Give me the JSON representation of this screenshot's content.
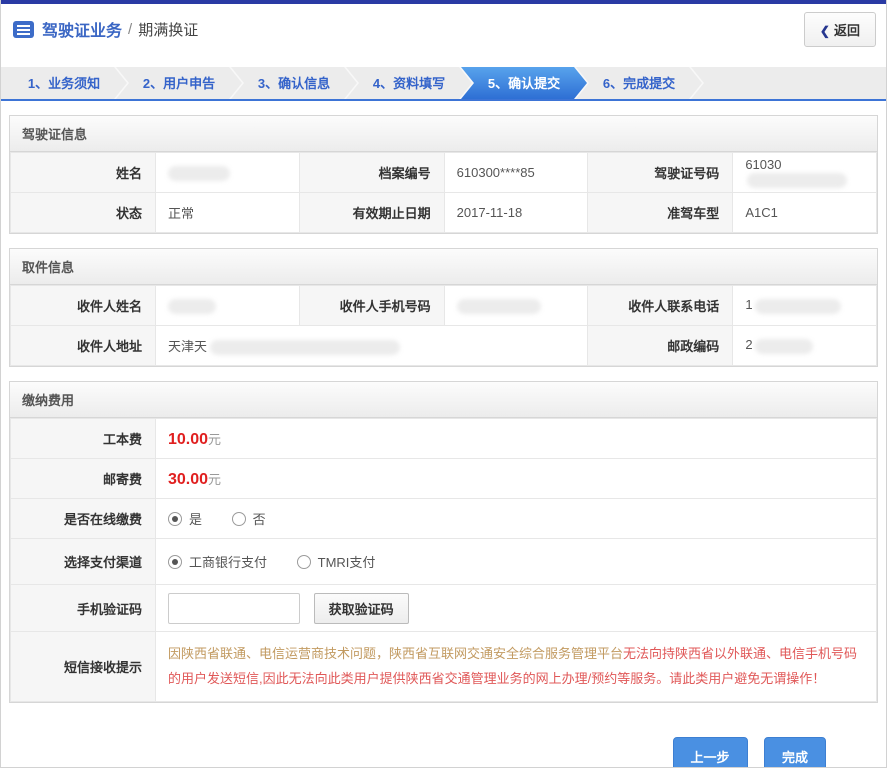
{
  "colors": {
    "accent_blue": "#3d74d6",
    "top_bar": "#2a3aa4",
    "price_red": "#e01f1f",
    "notice_tan": "#c29a60",
    "notice_red": "#e05858"
  },
  "header": {
    "icon": "form-list-icon",
    "title": "驾驶证业务",
    "separator": "/",
    "subtitle": "期满换证",
    "back_chevron": "❮",
    "back_button": "返回"
  },
  "steps": [
    "1、业务须知",
    "2、用户申告",
    "3、确认信息",
    "4、资料填写",
    "5、确认提交",
    "6、完成提交"
  ],
  "active_step": "5、确认提交",
  "license": {
    "title": "驾驶证信息",
    "name_label": "姓名",
    "file_no_label": "档案编号",
    "file_no_value": "610300****85",
    "license_no_label": "驾驶证号码",
    "license_no_prefix": "61030",
    "status_label": "状态",
    "status_value": "正常",
    "expiry_label": "有效期止日期",
    "expiry_value": "2017-11-18",
    "vehicle_label": "准驾车型",
    "vehicle_value": "A1C1"
  },
  "pickup": {
    "title": "取件信息",
    "recipient_name_label": "收件人姓名",
    "recipient_mobile_label": "收件人手机号码",
    "recipient_tel_label": "收件人联系电话",
    "recipient_tel_prefix": "1",
    "address_label": "收件人地址",
    "address_prefix": "天津天",
    "zip_label": "邮政编码",
    "zip_prefix": "2"
  },
  "fees": {
    "title": "缴纳费用",
    "work_fee_label": "工本费",
    "work_fee_value": "10.00",
    "post_fee_label": "邮寄费",
    "post_fee_value": "30.00",
    "fee_unit": "元",
    "online_label": "是否在线缴费",
    "online_yes": "是",
    "online_no": "否",
    "online_selected": "是",
    "channel_label": "选择支付渠道",
    "channel_icbc": "工商银行支付",
    "channel_tmri": "TMRI支付",
    "channel_selected": "工商银行支付",
    "code_label": "手机验证码",
    "code_input_value": "",
    "get_code_button": "获取验证码",
    "sms_label": "短信接收提示",
    "sms_notice_part1": "因陕西省联通、电信运营商技术问题，陕西省互联网交通安全综合服务管理平台",
    "sms_notice_part2": "无法向持陕西省以外联通、电信手机号码的用户发送短信,因此无法向此类用户提供陕西省交通管理业务的网上办理/预约等服务。请此类用户避免无谓操作！"
  },
  "footer": {
    "prev_button": "上一步",
    "done_button": "完成"
  }
}
